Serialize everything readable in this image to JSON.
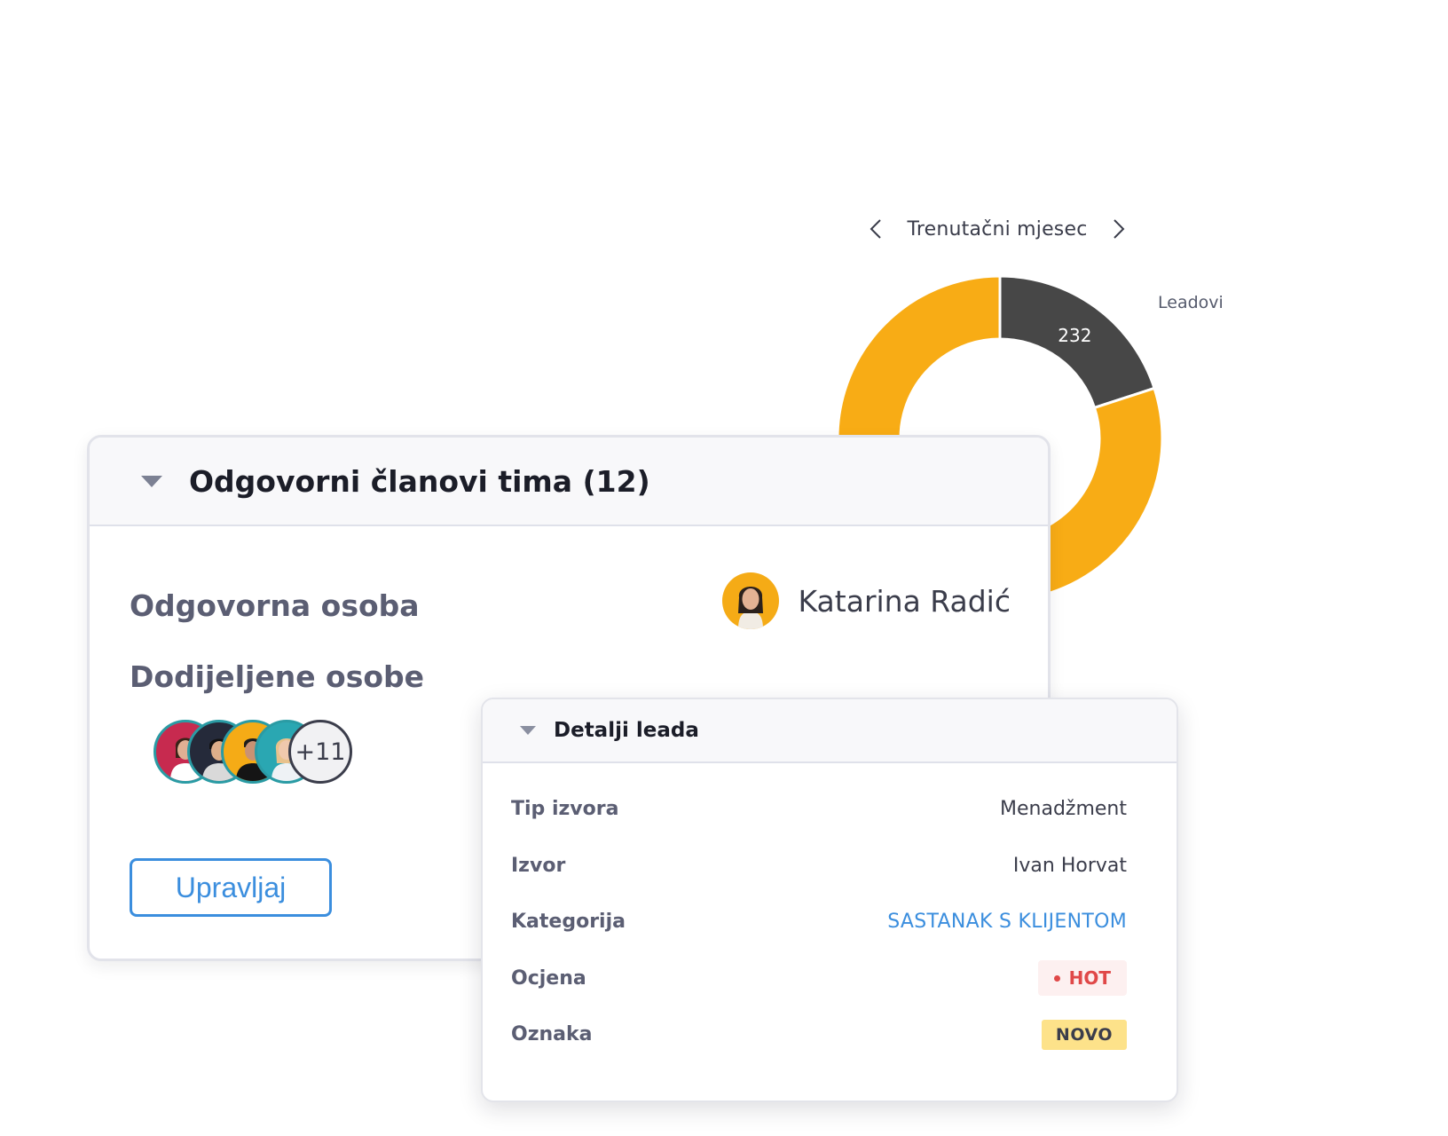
{
  "chart_nav": {
    "prev_icon": "chevron-left-icon",
    "month_label": "Trenutačni mjesec",
    "next_icon": "chevron-right-icon"
  },
  "chart_data": {
    "type": "pie",
    "donut": true,
    "slices": [
      {
        "label": "Leadovi",
        "value": 232,
        "color": "#474747"
      },
      {
        "label": "",
        "value": 928,
        "color": "#f8ac15"
      }
    ],
    "data_labels": [
      "232"
    ],
    "legend": [
      "Leadovi"
    ]
  },
  "team_card": {
    "title": "Odgovorni članovi tima (12)",
    "responsible_label": "Odgovorna osoba",
    "responsible_name": "Katarina Radić",
    "assigned_label": "Dodijeljene osobe",
    "assigned_more": "+11",
    "manage_button": "Upravljaj"
  },
  "lead_card": {
    "title": "Detalji leada",
    "rows": [
      {
        "label": "Tip izvora",
        "value": "Menadžment"
      },
      {
        "label": "Izvor",
        "value": "Ivan Horvat"
      },
      {
        "label": "Kategorija",
        "value": "SASTANAK S KLIJENTOM"
      },
      {
        "label": "Ocjena",
        "value": "HOT"
      },
      {
        "label": "Oznaka",
        "value": "NOVO"
      }
    ]
  },
  "colors": {
    "accent_blue": "#3b8ede",
    "donut_orange": "#f8ac15",
    "donut_dark": "#474747",
    "hot_red": "#e04848",
    "new_yellow": "#fde28a"
  }
}
